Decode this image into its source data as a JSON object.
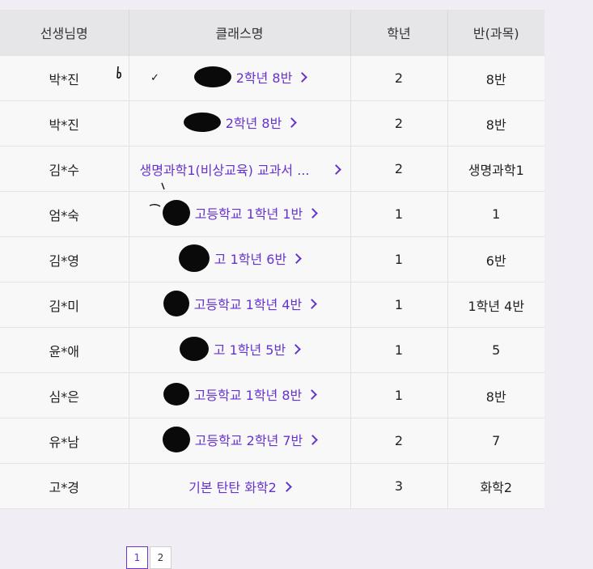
{
  "table": {
    "headers": [
      "선생님명",
      "클래스명",
      "학년",
      "반(과목)"
    ],
    "rows": [
      {
        "teacher": "박*진",
        "class": "2학년 8반",
        "grade": "2",
        "section": "8반"
      },
      {
        "teacher": "박*진",
        "class": "2학년 8반",
        "grade": "2",
        "section": "8반"
      },
      {
        "teacher": "김*수",
        "class": "생명과학1(비상교육) 교과서 ...",
        "grade": "2",
        "section": "생명과학1"
      },
      {
        "teacher": "엄*숙",
        "class": "고등학교 1학년 1반",
        "grade": "1",
        "section": "1"
      },
      {
        "teacher": "김*영",
        "class": "고 1학년 6반",
        "grade": "1",
        "section": "6반"
      },
      {
        "teacher": "김*미",
        "class": "고등학교 1학년 4반",
        "grade": "1",
        "section": "1학년 4반"
      },
      {
        "teacher": "윤*애",
        "class": "고 1학년 5반",
        "grade": "1",
        "section": "5"
      },
      {
        "teacher": "심*은",
        "class": "고등학교 1학년 8반",
        "grade": "1",
        "section": "8반"
      },
      {
        "teacher": "유*남",
        "class": "고등학교 2학년 7반",
        "grade": "2",
        "section": "7"
      },
      {
        "teacher": "고*경",
        "class": "기본 탄탄 화학2",
        "grade": "3",
        "section": "화학2"
      }
    ]
  },
  "pagination": {
    "pages": [
      "1",
      "2"
    ],
    "current": "1"
  },
  "colors": {
    "link": "#6633cc",
    "header_bg": "#e6e6e8",
    "row_bg": "#f8f8f8",
    "page_bg": "#f0eef4"
  }
}
